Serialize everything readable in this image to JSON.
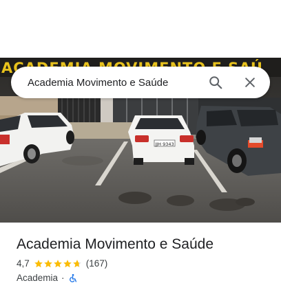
{
  "search": {
    "query": "Academia Movimento e Saúde"
  },
  "photo": {
    "sign_text": "ACADEMIA MOVIMENTO E SAÚ",
    "plate_text": "JJH 9343"
  },
  "place": {
    "title": "Academia Movimento e Saúde",
    "rating": "4,7",
    "stars_value": 4.7,
    "stars_max": 5,
    "reviews": "(167)",
    "category": "Academia",
    "separator": "·",
    "accessibility_icon": "wheelchair-icon"
  },
  "colors": {
    "star": "#fbbc04",
    "star_empty": "#dadce0",
    "accessibility": "#1a73e8"
  }
}
